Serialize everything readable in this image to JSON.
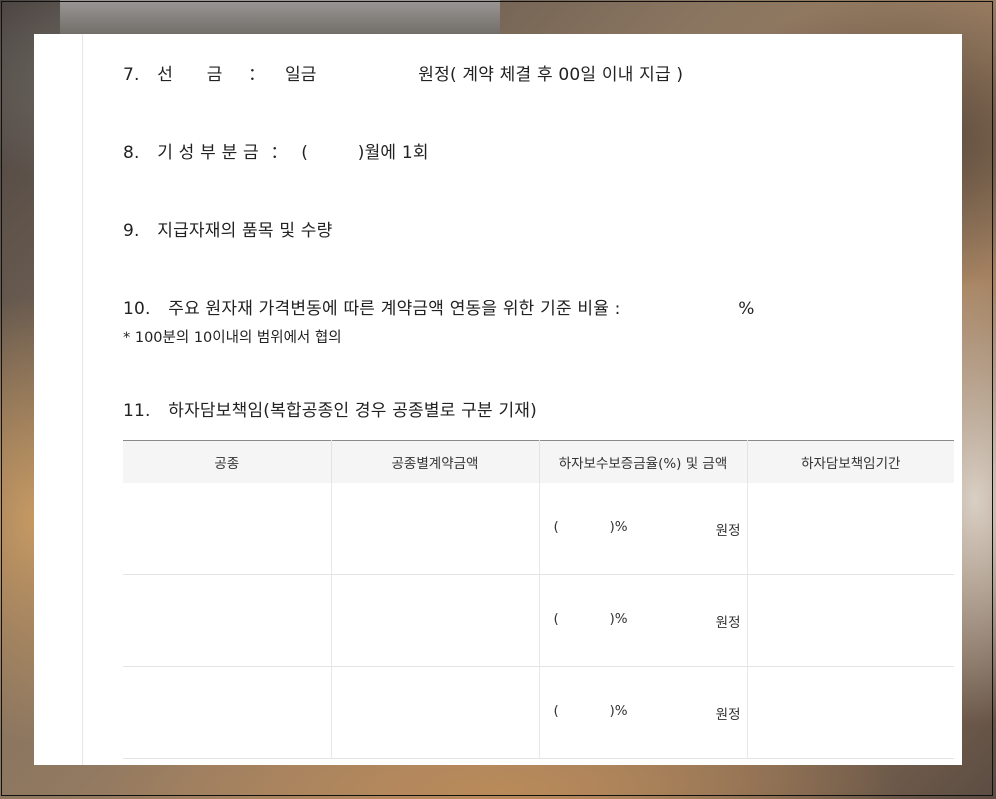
{
  "items": {
    "i7": {
      "num": "7.",
      "label": "선      금",
      "colon": "：",
      "prefix": "일금",
      "suffix": "원정( 계약 체결 후 00일 이내 지급 )"
    },
    "i8": {
      "num": "8.",
      "label": "기 성 부 분 금",
      "colon": "：",
      "open": "(",
      "suffix": ")월에 1회"
    },
    "i9": {
      "num": "9.",
      "label": "지급자재의 품목 및 수량"
    },
    "i10": {
      "num": "10.",
      "label": "주요 원자재 가격변동에 따른 계약금액 연동을 위한 기준 비율 :",
      "unit": "%",
      "note": "* 100분의 10이내의 범위에서 협의"
    },
    "i11": {
      "num": "11.",
      "label": "하자담보책임(복합공종인 경우 공종별로 구분 기재)"
    }
  },
  "table": {
    "headers": [
      "공종",
      "공종별계약금액",
      "하자보수보증금율(%) 및 금액",
      "하자담보책임기간"
    ],
    "rows": [
      {
        "open": "(",
        "pct": ")%",
        "won": "원정"
      },
      {
        "open": "(",
        "pct": ")%",
        "won": "원정"
      },
      {
        "open": "(",
        "pct": ")%",
        "won": "원정"
      }
    ]
  }
}
